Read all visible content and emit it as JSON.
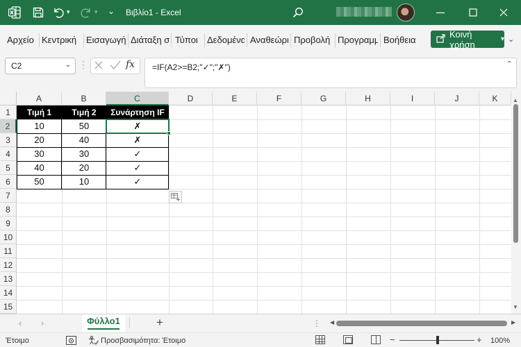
{
  "titlebar": {
    "app_icon": "excel-icon",
    "qat_more": "⌄",
    "title": "Βιβλίο1  -  Excel",
    "colors": {
      "background": "#217346",
      "text": "#ffffff"
    }
  },
  "ribbon": {
    "tabs": [
      {
        "label": "Αρχείο"
      },
      {
        "label": "Κεντρική"
      },
      {
        "label": "Εισαγωγή"
      },
      {
        "label": "Διάταξη σελίδας"
      },
      {
        "label": "Τύποι"
      },
      {
        "label": "Δεδομένα"
      },
      {
        "label": "Αναθεώρηση"
      },
      {
        "label": "Προβολή"
      },
      {
        "label": "Προγραμματιστής"
      },
      {
        "label": "Βοήθεια"
      }
    ],
    "share_label": "Κοινή χρήση",
    "share_color": "#217346"
  },
  "formula_bar": {
    "name_box": "C2",
    "fx_label": "fx",
    "formula": "=IF(A2>=B2;\"✓\";\"✗\")"
  },
  "grid": {
    "columns": [
      "A",
      "B",
      "C",
      "D",
      "E",
      "F",
      "G",
      "H",
      "I",
      "J",
      "K"
    ],
    "rows": [
      "1",
      "2",
      "3",
      "4",
      "5",
      "6",
      "7",
      "8",
      "9",
      "10",
      "11",
      "12",
      "13",
      "14",
      "15"
    ],
    "active_column": "C",
    "active_row": "2",
    "selected_cell": "C2",
    "headers": [
      "Τιμή 1",
      "Τιμή 2",
      "Συνάρτηση IF"
    ],
    "rows_data": [
      [
        "10",
        "50",
        "✗"
      ],
      [
        "20",
        "40",
        "✗"
      ],
      [
        "30",
        "30",
        "✓"
      ],
      [
        "40",
        "20",
        "✓"
      ],
      [
        "50",
        "10",
        "✓"
      ]
    ],
    "accent_color": "#217346"
  },
  "sheets": {
    "tabs": [
      {
        "label": "Φύλλο1",
        "active": true
      }
    ],
    "add_label": "+"
  },
  "statusbar": {
    "ready": "Έτοιμο",
    "accessibility": "Προσβασιμότητα: Έτοιμο",
    "zoom_minus": "−",
    "zoom_plus": "+",
    "zoom_level": "100%"
  }
}
